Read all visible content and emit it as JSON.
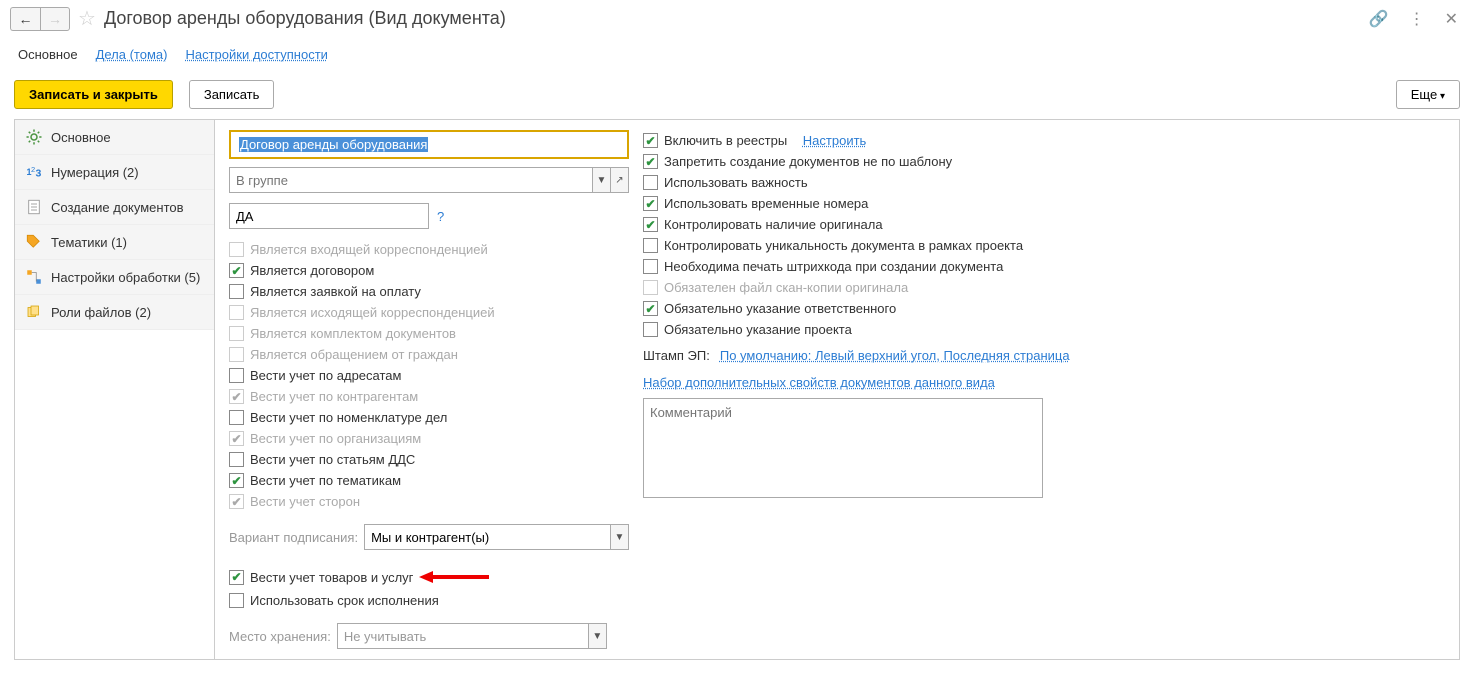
{
  "header": {
    "title": "Договор аренды оборудования (Вид документа)"
  },
  "nav_tabs": {
    "main": "Основное",
    "cases": "Дела (тома)",
    "access": "Настройки доступности"
  },
  "toolbar": {
    "save_close": "Записать и закрыть",
    "save": "Записать",
    "more": "Еще"
  },
  "sidebar": {
    "items": [
      {
        "label": "Основное",
        "icon": "gear"
      },
      {
        "label": "Нумерация (2)",
        "icon": "num"
      },
      {
        "label": "Создание документов",
        "icon": "doc"
      },
      {
        "label": "Тематики (1)",
        "icon": "tag"
      },
      {
        "label": "Настройки обработки (5)",
        "icon": "flow"
      },
      {
        "label": "Роли файлов (2)",
        "icon": "files"
      }
    ]
  },
  "form": {
    "name_value": "Договор аренды оборудования",
    "group_placeholder": "В группе",
    "code_value": "ДА",
    "signing_label": "Вариант подписания:",
    "signing_value": "Мы и контрагент(ы)",
    "storage_label": "Место хранения:",
    "storage_value": "Не учитывать"
  },
  "checks_left": [
    {
      "label": "Является входящей корреспонденцией",
      "checked": false,
      "disabled": true
    },
    {
      "label": "Является договором",
      "checked": true,
      "disabled": false
    },
    {
      "label": "Является заявкой на оплату",
      "checked": false,
      "disabled": false
    },
    {
      "label": "Является исходящей корреспонденцией",
      "checked": false,
      "disabled": true
    },
    {
      "label": "Является комплектом документов",
      "checked": false,
      "disabled": true
    },
    {
      "label": "Является обращением от граждан",
      "checked": false,
      "disabled": true
    },
    {
      "label": "Вести учет по адресатам",
      "checked": false,
      "disabled": false
    },
    {
      "label": "Вести учет по контрагентам",
      "checked": true,
      "disabled": true
    },
    {
      "label": "Вести учет по номенклатуре дел",
      "checked": false,
      "disabled": false
    },
    {
      "label": "Вести учет по организациям",
      "checked": true,
      "disabled": true
    },
    {
      "label": "Вести учет по статьям ДДС",
      "checked": false,
      "disabled": false
    },
    {
      "label": "Вести учет по тематикам",
      "checked": true,
      "disabled": false
    },
    {
      "label": "Вести учет сторон",
      "checked": true,
      "disabled": true
    }
  ],
  "checks_left_after": [
    {
      "label": "Вести учет товаров и услуг",
      "checked": true,
      "disabled": false,
      "arrow": true
    },
    {
      "label": "Использовать срок исполнения",
      "checked": false,
      "disabled": false
    }
  ],
  "checks_right": [
    {
      "label": "Включить в реестры",
      "checked": true,
      "link": "Настроить"
    },
    {
      "label": "Запретить создание документов не по шаблону",
      "checked": true
    },
    {
      "label": "Использовать важность",
      "checked": false
    },
    {
      "label": "Использовать временные номера",
      "checked": true
    },
    {
      "label": "Контролировать наличие оригинала",
      "checked": true
    },
    {
      "label": "Контролировать уникальность документа в рамках проекта",
      "checked": false
    },
    {
      "label": "Необходима печать штрихкода при создании документа",
      "checked": false
    },
    {
      "label": "Обязателен файл скан-копии оригинала",
      "checked": false,
      "disabled": true
    },
    {
      "label": "Обязательно указание ответственного",
      "checked": true
    },
    {
      "label": "Обязательно указание проекта",
      "checked": false
    }
  ],
  "stamp": {
    "label": "Штамп ЭП:",
    "link": "По умолчанию: Левый верхний угол, Последняя страница"
  },
  "extra_link": "Набор дополнительных свойств документов данного вида",
  "comment_placeholder": "Комментарий"
}
